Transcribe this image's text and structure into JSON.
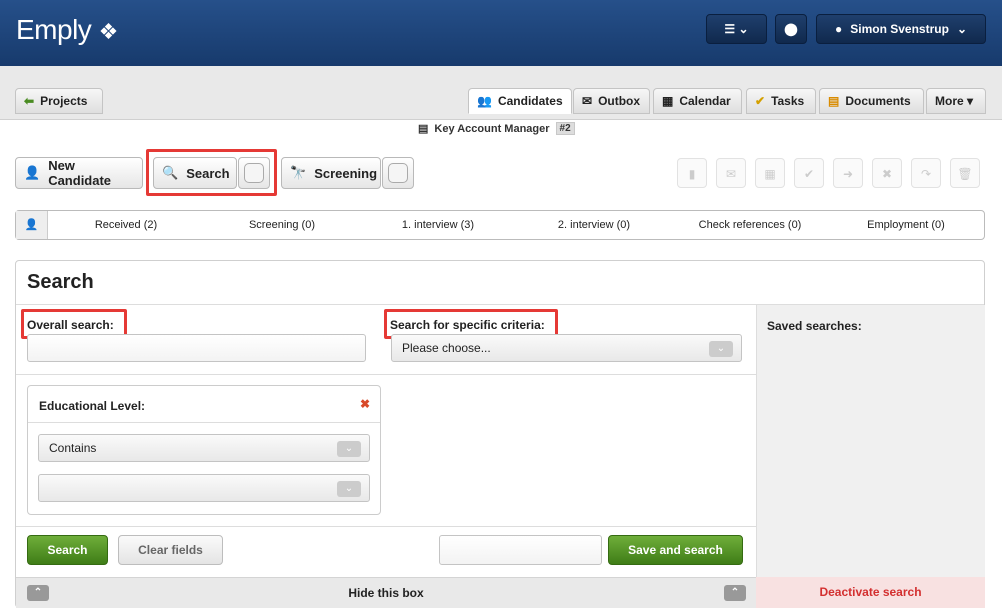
{
  "app": {
    "logo": "Emply",
    "logo_mark": "❖",
    "user": "Simon Svenstrup"
  },
  "tabs": {
    "projects": "Projects",
    "candidates": "Candidates",
    "outbox": "Outbox",
    "calendar": "Calendar",
    "tasks": "Tasks",
    "documents": "Documents",
    "more": "More ▾"
  },
  "job": {
    "title": "Key Account Manager",
    "number": "#2"
  },
  "toolbar": {
    "new_candidate": "New Candidate",
    "search": "Search",
    "screening": "Screening"
  },
  "pipeline": [
    "Received (2)",
    "Screening (0)",
    "1. interview (3)",
    "2. interview (0)",
    "Check references (0)",
    "Employment (0)"
  ],
  "panel": {
    "title": "Search",
    "overall_label": "Overall search:",
    "specific_label": "Search for specific criteria:",
    "specific_value": "Please choose...",
    "saved_label": "Saved searches:",
    "criterion": {
      "title": "Educational Level:",
      "operator": "Contains"
    },
    "search_btn": "Search",
    "clear_btn": "Clear fields",
    "save_btn": "Save and search",
    "hide": "Hide this box",
    "deactivate": "Deactivate search"
  }
}
